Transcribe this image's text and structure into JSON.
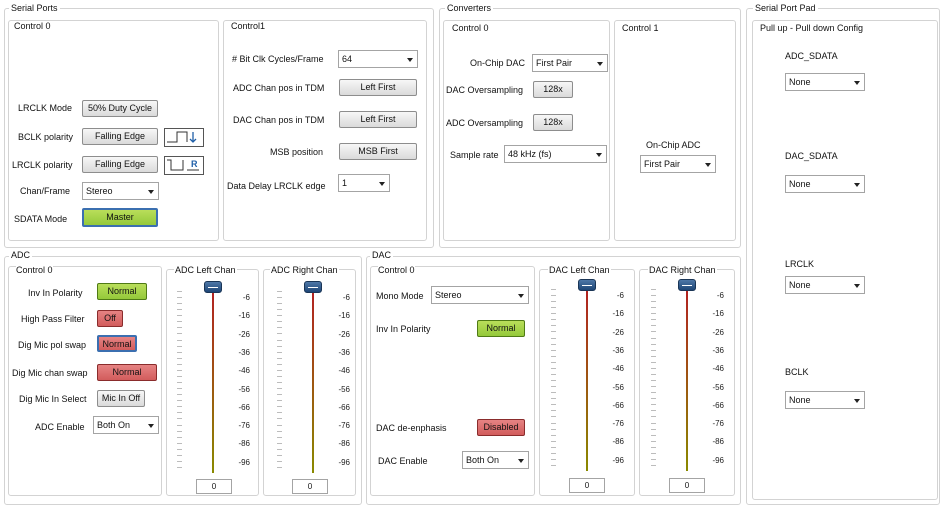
{
  "serial_ports": {
    "title": "Serial Ports",
    "control0": {
      "title": "Control 0",
      "lrclk_mode_label": "LRCLK Mode",
      "lrclk_mode_value": "50% Duty Cycle",
      "bclk_polarity_label": "BCLK polarity",
      "bclk_polarity_value": "Falling Edge",
      "lrclk_polarity_label": "LRCLK polarity",
      "lrclk_polarity_value": "Falling Edge",
      "lrclk_wave_letter": "R",
      "chan_frame_label": "Chan/Frame",
      "chan_frame_value": "Stereo",
      "sdata_mode_label": "SDATA  Mode",
      "sdata_mode_value": "Master"
    },
    "control1": {
      "title": "Control1",
      "bit_clk_label": "# Bit Clk Cycles/Frame",
      "bit_clk_value": "64",
      "adc_chan_pos_label": "ADC Chan pos in TDM",
      "adc_chan_pos_value": "Left First",
      "dac_chan_pos_label": "DAC Chan pos in TDM",
      "dac_chan_pos_value": "Left First",
      "msb_position_label": "MSB position",
      "msb_position_value": "MSB First",
      "data_delay_label": "Data Delay LRCLK edge",
      "data_delay_value": "1"
    }
  },
  "converters": {
    "title": "Converters",
    "control0": {
      "title": "Control 0",
      "onchip_dac_label": "On-Chip DAC",
      "onchip_dac_value": "First Pair",
      "dac_oversampling_label": "DAC Oversampling",
      "dac_oversampling_value": "128x",
      "adc_oversampling_label": "ADC Oversampling",
      "adc_oversampling_value": "128x",
      "sample_rate_label": "Sample rate",
      "sample_rate_value": "48 kHz (fs)"
    },
    "control1": {
      "title": "Control 1",
      "onchip_adc_label": "On-Chip ADC",
      "onchip_adc_value": "First Pair"
    }
  },
  "serial_port_pad": {
    "title": "Serial Port Pad",
    "subtitle": "Pull up - Pull down Config",
    "adc_sdata_label": "ADC_SDATA",
    "adc_sdata_value": "None",
    "dac_sdata_label": "DAC_SDATA",
    "dac_sdata_value": "None",
    "lrclk_label": "LRCLK",
    "lrclk_value": "None",
    "bclk_label": "BCLK",
    "bclk_value": "None"
  },
  "adc": {
    "title": "ADC",
    "control0": {
      "title": "Control 0",
      "inv_in_polarity_label": "Inv In Polarity",
      "inv_in_polarity_value": "Normal",
      "high_pass_label": "High Pass Filter",
      "high_pass_value": "Off",
      "dig_mic_pol_label": "Dig Mic pol swap",
      "dig_mic_pol_value": "Normal",
      "dig_mic_chan_label": "Dig Mic chan swap",
      "dig_mic_chan_value": "Normal",
      "dig_mic_in_label": "Dig Mic In Select",
      "dig_mic_in_value": "Mic In Off",
      "adc_enable_label": "ADC Enable",
      "adc_enable_value": "Both On"
    },
    "left_chan": {
      "title": "ADC Left Chan",
      "value": "0"
    },
    "right_chan": {
      "title": "ADC Right Chan",
      "value": "0"
    }
  },
  "dac": {
    "title": "DAC",
    "control0": {
      "title": "Control 0",
      "mono_mode_label": "Mono Mode",
      "mono_mode_value": "Stereo",
      "inv_in_polarity_label": "Inv In Polarity",
      "inv_in_polarity_value": "Normal",
      "deemphasis_label": "DAC de-enphasis",
      "deemphasis_value": "Disabled",
      "dac_enable_label": "DAC Enable",
      "dac_enable_value": "Both On"
    },
    "left_chan": {
      "title": "DAC Left Chan",
      "value": "0"
    },
    "right_chan": {
      "title": "DAC Right Chan",
      "value": "0"
    }
  },
  "slider_scale": [
    "-6",
    "-16",
    "-26",
    "-36",
    "-46",
    "-56",
    "-66",
    "-76",
    "-86",
    "-96"
  ],
  "colors": {
    "toggle_green": "#a5d24a",
    "toggle_red": "#d86a6a",
    "slider_thumb": "#2c5a8e",
    "slider_track_top": "#b22222",
    "slider_track_bottom": "#8a8a00"
  }
}
